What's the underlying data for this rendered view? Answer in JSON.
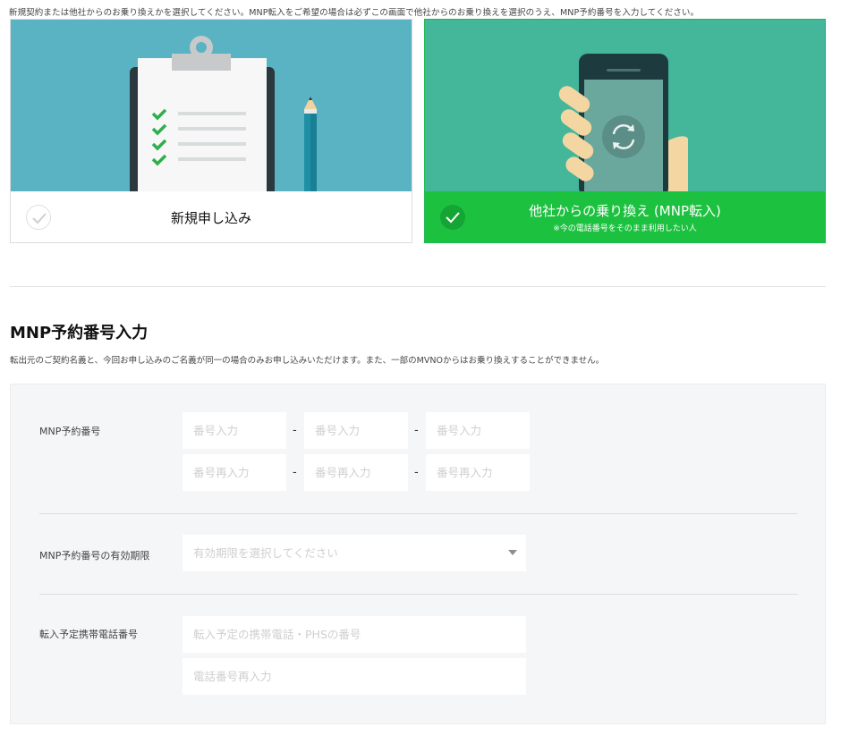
{
  "intro_text": "新規契約または他社からのお乗り換えかを選択してください。MNP転入をご希望の場合は必ずこの画面で他社からのお乗り換えを選択のうえ、MNP予約番号を入力してください。",
  "plan_cards": {
    "new": {
      "title": "新規申し込み",
      "selected": false,
      "image_icon": "clipboard-checklist-icon"
    },
    "mnp": {
      "title": "他社からの乗り換え (MNP転入)",
      "subtitle": "※今の電話番号をそのまま利用したい人",
      "selected": true,
      "image_icon": "phone-switch-icon"
    }
  },
  "section": {
    "title": "MNP予約番号入力",
    "description": "転出元のご契約名義と、今回お申し込みのご名義が同一の場合のみお申し込みいただけます。また、一部のMVNOからはお乗り換えすることができません。"
  },
  "form": {
    "mnp_number": {
      "label": "MNP予約番号",
      "placeholder": "番号入力",
      "confirm_placeholder": "番号再入力",
      "separator": "-"
    },
    "expiry": {
      "label": "MNP予約番号の有効期限",
      "placeholder": "有効期限を選択してください"
    },
    "phone": {
      "label": "転入予定携帯電話番号",
      "placeholder": "転入予定の携帯電話・PHSの番号",
      "confirm_placeholder": "電話番号再入力"
    }
  },
  "colors": {
    "accent_green": "#1dc140",
    "card_new_bg": "#5ab3c3",
    "card_mnp_bg": "#44b79b",
    "panel_bg": "#f5f6f7"
  }
}
